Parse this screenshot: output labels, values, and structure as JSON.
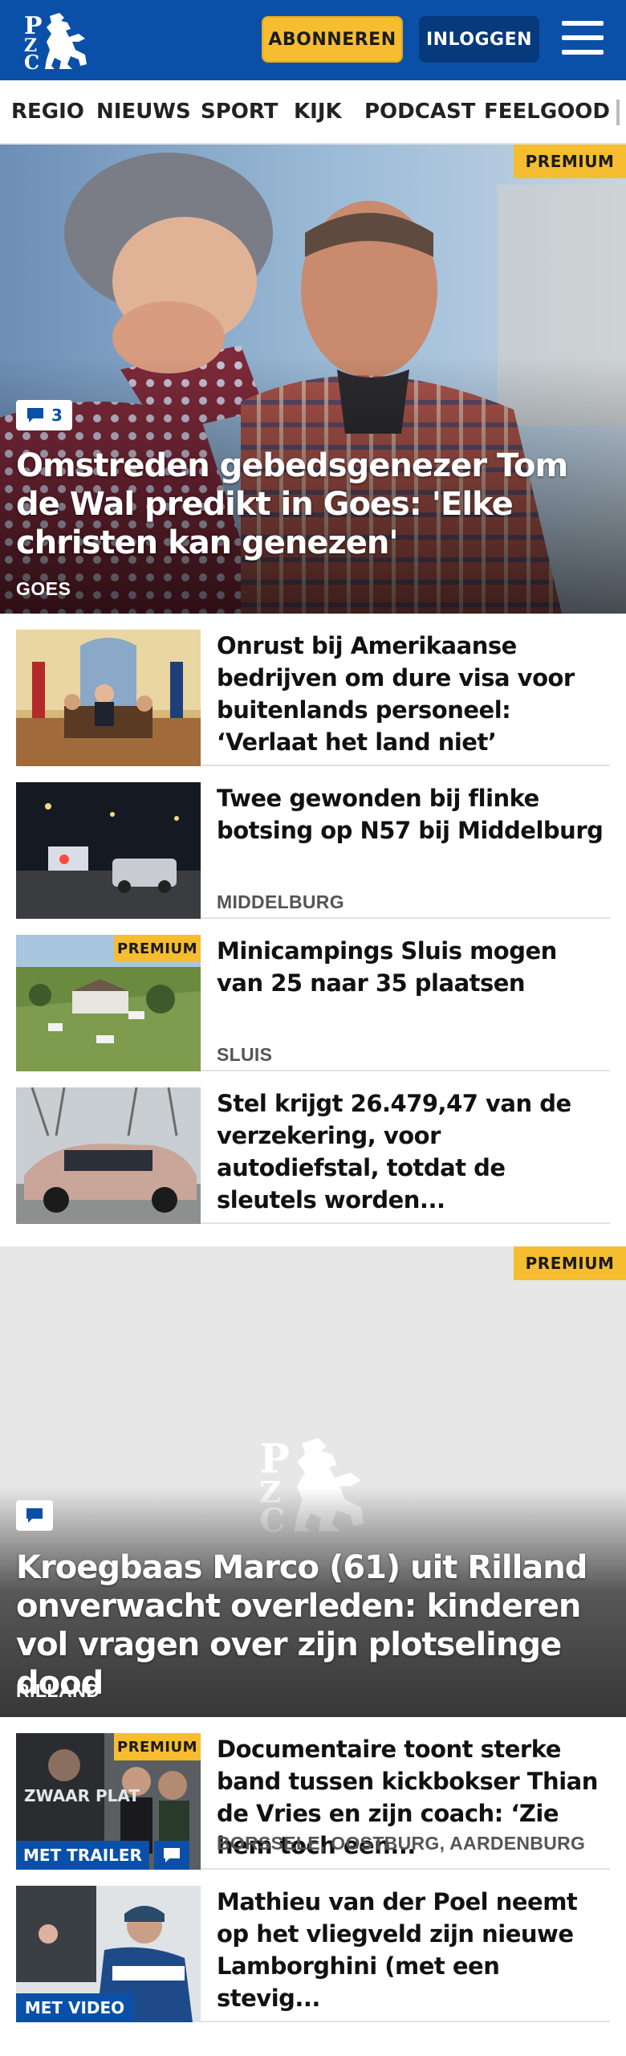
{
  "header": {
    "subscribe_label": "ABONNEREN",
    "login_label": "INLOGGEN",
    "brand_color": "#0a50a8",
    "accent_color": "#f5bd2f"
  },
  "nav": {
    "items": [
      "REGIO",
      "NIEUWS",
      "SPORT",
      "KIJK",
      "PODCAST",
      "FEELGOOD"
    ]
  },
  "hero": {
    "premium_label": "PREMIUM",
    "comment_count": "3",
    "title": "Omstreden gebedsgenezer Tom de Wal predikt in Goes: 'Elke christen kan genezen'",
    "location": "GOES"
  },
  "articles": [
    {
      "title": "Onrust bij Amerikaanse bedrijven om dure visa voor buitenlands personeel: ‘Verlaat het land niet’"
    },
    {
      "title": "Twee gewonden bij flinke botsing op N57 bij Middelburg",
      "location": "MIDDELBURG"
    },
    {
      "title": "Minicampings Sluis mogen van 25 naar 35 plaatsen",
      "location": "SLUIS",
      "premium_label": "PREMIUM"
    },
    {
      "title": "Stel krijgt 26.479,47 van de verzekering, voor autodiefstal, totdat de sleutels worden..."
    }
  ],
  "hero2": {
    "premium_label": "PREMIUM",
    "title": "Kroegbaas Marco (61) uit Rilland onverwacht overleden: kinderen vol vragen over zijn plotselinge dood",
    "location": "RILLAND"
  },
  "articles2": [
    {
      "title": "Documentaire toont sterke band tussen kickbokser Thian de Vries en zijn coach: ‘Zie hem toch een...",
      "location": "BORSSELE, OOSTBURG, AARDENBURG",
      "premium_label": "PREMIUM",
      "tag_label": "MET TRAILER",
      "thumb_text": "ZWAAR PLAT"
    },
    {
      "title": "Mathieu van der Poel neemt op het vliegveld zijn nieuwe Lamborghini (met een stevig...",
      "tag_label": "MET VIDEO"
    }
  ]
}
